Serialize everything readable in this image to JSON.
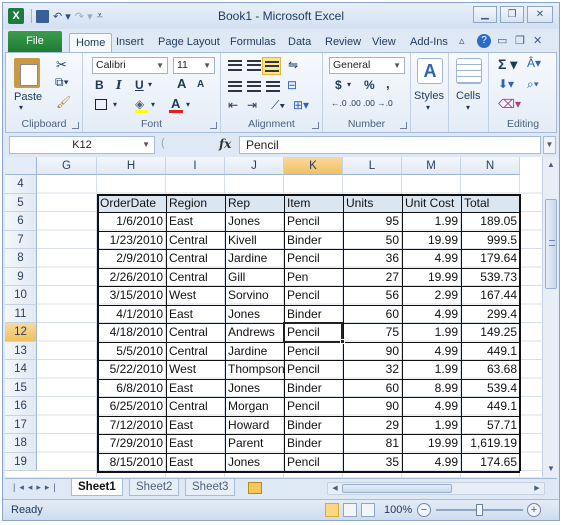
{
  "window": {
    "title": "Book1 - Microsoft Excel",
    "app_icon": "X"
  },
  "tabs": [
    "File",
    "Home",
    "Insert",
    "Page Layout",
    "Formulas",
    "Data",
    "Review",
    "View",
    "Add-Ins"
  ],
  "active_tab": "Home",
  "ribbon": {
    "clipboard": {
      "label": "Clipboard",
      "paste": "Paste"
    },
    "font": {
      "label": "Font",
      "name": "Calibri",
      "size": "11",
      "bold": "B",
      "italic": "I",
      "underline": "U",
      "grow": "A",
      "shrink": "A"
    },
    "alignment": {
      "label": "Alignment"
    },
    "number": {
      "label": "Number",
      "format": "General",
      "currency": "$",
      "percent": "%",
      "comma": ",",
      "inc_dec": "←.0 .00",
      "dec_dec": ".00 →.0"
    },
    "styles": {
      "label": "Styles"
    },
    "cells": {
      "label": "Cells"
    },
    "editing": {
      "label": "Editing"
    }
  },
  "formula_bar": {
    "name_box": "K12",
    "fx": "fx",
    "value": "Pencil"
  },
  "grid": {
    "columns": [
      "G",
      "H",
      "I",
      "J",
      "K",
      "L",
      "M",
      "N"
    ],
    "selected_column": "K",
    "rows": [
      "4",
      "5",
      "6",
      "7",
      "8",
      "9",
      "10",
      "11",
      "12",
      "13",
      "14",
      "15",
      "16",
      "17",
      "18",
      "19"
    ],
    "selected_row": "12",
    "table_headers": [
      "OrderDate",
      "Region",
      "Rep",
      "Item",
      "Units",
      "Unit Cost",
      "Total"
    ],
    "table_rows": [
      [
        "1/6/2010",
        "East",
        "Jones",
        "Pencil",
        "95",
        "1.99",
        "189.05"
      ],
      [
        "1/23/2010",
        "Central",
        "Kivell",
        "Binder",
        "50",
        "19.99",
        "999.5"
      ],
      [
        "2/9/2010",
        "Central",
        "Jardine",
        "Pencil",
        "36",
        "4.99",
        "179.64"
      ],
      [
        "2/26/2010",
        "Central",
        "Gill",
        "Pen",
        "27",
        "19.99",
        "539.73"
      ],
      [
        "3/15/2010",
        "West",
        "Sorvino",
        "Pencil",
        "56",
        "2.99",
        "167.44"
      ],
      [
        "4/1/2010",
        "East",
        "Jones",
        "Binder",
        "60",
        "4.99",
        "299.4"
      ],
      [
        "4/18/2010",
        "Central",
        "Andrews",
        "Pencil",
        "75",
        "1.99",
        "149.25"
      ],
      [
        "5/5/2010",
        "Central",
        "Jardine",
        "Pencil",
        "90",
        "4.99",
        "449.1"
      ],
      [
        "5/22/2010",
        "West",
        "Thompson",
        "Pencil",
        "32",
        "1.99",
        "63.68"
      ],
      [
        "6/8/2010",
        "East",
        "Jones",
        "Binder",
        "60",
        "8.99",
        "539.4"
      ],
      [
        "6/25/2010",
        "Central",
        "Morgan",
        "Pencil",
        "90",
        "4.99",
        "449.1"
      ],
      [
        "7/12/2010",
        "East",
        "Howard",
        "Binder",
        "29",
        "1.99",
        "57.71"
      ],
      [
        "7/29/2010",
        "East",
        "Parent",
        "Binder",
        "81",
        "19.99",
        "1,619.19"
      ],
      [
        "8/15/2010",
        "East",
        "Jones",
        "Pencil",
        "35",
        "4.99",
        "174.65"
      ]
    ]
  },
  "sheets": [
    "Sheet1",
    "Sheet2",
    "Sheet3"
  ],
  "active_sheet": "Sheet1",
  "status": {
    "text": "Ready",
    "zoom": "100%",
    "zoom_out": "−",
    "zoom_in": "+"
  },
  "colors": {
    "file_tab": "#207a33",
    "selected_header": "#f1c15f",
    "table_header_fill": "#dce6f1"
  }
}
